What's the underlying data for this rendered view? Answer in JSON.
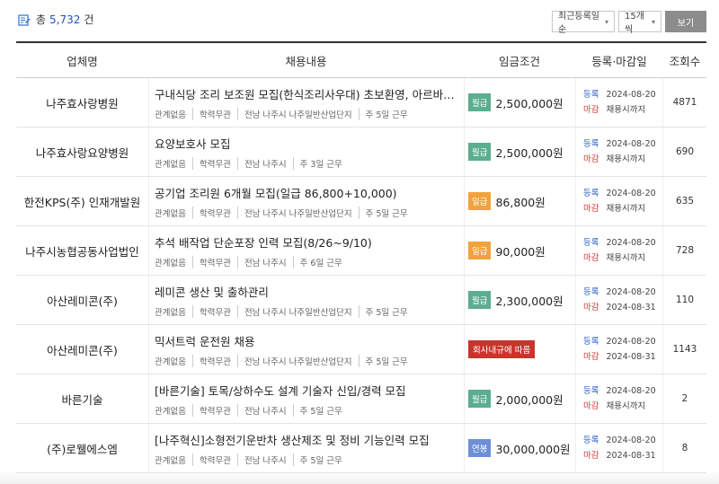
{
  "summary": {
    "prefix": "총",
    "count": "5,732",
    "suffix": "건"
  },
  "controls": {
    "sort": "최근등록일순",
    "page_size": "15개씩",
    "view_button": "보기"
  },
  "headers": [
    "업체명",
    "채용내용",
    "임금조건",
    "등록·마감일",
    "조회수"
  ],
  "labels": {
    "registered": "등록",
    "deadline": "마감"
  },
  "colors": {
    "monthly": "#5bae8f",
    "daily": "#f0a33c",
    "annual": "#6d8fd6",
    "internal_rule": "#c8352d",
    "count": "#1a56b8"
  },
  "rows": [
    {
      "company": "나주효사랑병원",
      "title": "구내식당 조리 보조원 모집(한식조리사우대) 초보환영, 아르바이트…",
      "meta": [
        "관계없음",
        "학력무관",
        "전남 나주시 나주일반산업단지",
        "주 5일 근무"
      ],
      "wage_type": "월급",
      "wage": "2,500,000원",
      "registered": "2024-08-20",
      "deadline": "채용시까지",
      "views": "4871"
    },
    {
      "company": "나주효사랑요양병원",
      "title": "요양보호사 모집",
      "meta": [
        "관계없음",
        "학력무관",
        "전남 나주시",
        "주 3일 근무"
      ],
      "wage_type": "월급",
      "wage": "2,500,000원",
      "registered": "2024-08-20",
      "deadline": "채용시까지",
      "views": "690"
    },
    {
      "company": "한전KPS(주) 인재개발원",
      "title": "공기업 조리원 6개월 모집(일급 86,800+10,000)",
      "meta": [
        "관계없음",
        "학력무관",
        "전남 나주시 나주일반산업단지",
        "주 5일 근무"
      ],
      "wage_type": "일급",
      "wage": "86,800원",
      "registered": "2024-08-20",
      "deadline": "채용시까지",
      "views": "635"
    },
    {
      "company": "나주시농협공동사업법인",
      "title": "추석 배작업 단순포장 인력 모집(8/26~9/10)",
      "meta": [
        "관계없음",
        "학력무관",
        "전남 나주시",
        "주 6일 근무"
      ],
      "wage_type": "일급",
      "wage": "90,000원",
      "registered": "2024-08-20",
      "deadline": "채용시까지",
      "views": "728"
    },
    {
      "company": "아산레미콘(주)",
      "title": "레미콘 생산 및 출하관리",
      "meta": [
        "관계없음",
        "학력무관",
        "전남 나주시 나주일반산업단지",
        "주 5일 근무"
      ],
      "wage_type": "월급",
      "wage": "2,300,000원",
      "registered": "2024-08-20",
      "deadline": "2024-08-31",
      "views": "110"
    },
    {
      "company": "아산레미콘(주)",
      "title": "믹서트럭 운전원 채용",
      "meta": [
        "관계없음",
        "학력무관",
        "전남 나주시 나주일반산업단지",
        "주 5일 근무"
      ],
      "wage_type": "회사내규에 따름",
      "wage": "",
      "registered": "2024-08-20",
      "deadline": "2024-08-31",
      "views": "1143"
    },
    {
      "company": "바른기술",
      "title": "[바른기술] 토목/상하수도 설계 기술자 신입/경력 모집",
      "meta": [
        "관계없음",
        "학력무관",
        "전남 나주시",
        "주 5일 근무"
      ],
      "wage_type": "월급",
      "wage": "2,000,000원",
      "registered": "2024-08-20",
      "deadline": "채용시까지",
      "views": "2"
    },
    {
      "company": "(주)로웰에스엠",
      "title": "[나주혁신]소형전기운반차 생산제조 및 정비 기능인력 모집",
      "meta": [
        "관계없음",
        "학력무관",
        "전남 나주시",
        "주 5일 근무"
      ],
      "wage_type": "연봉",
      "wage": "30,000,000원",
      "registered": "2024-08-20",
      "deadline": "2024-08-31",
      "views": "8"
    }
  ]
}
